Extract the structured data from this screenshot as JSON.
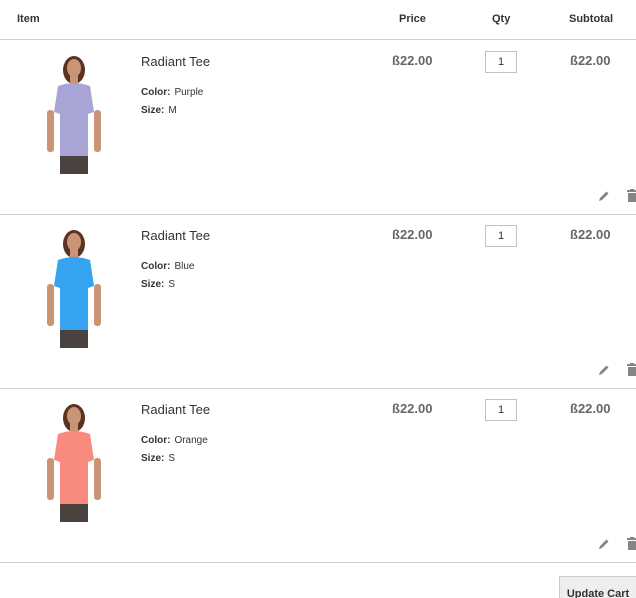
{
  "table_header": {
    "item": "Item",
    "price": "Price",
    "qty": "Qty",
    "subtotal": "Subtotal"
  },
  "labels": {
    "color": "Color:",
    "size": "Size:"
  },
  "items": [
    {
      "name": "Radiant Tee",
      "color": "Purple",
      "size": "M",
      "price": "ß22.00",
      "qty": "1",
      "subtotal": "ß22.00",
      "shirt_color": "#a8a4d6"
    },
    {
      "name": "Radiant Tee",
      "color": "Blue",
      "size": "S",
      "price": "ß22.00",
      "qty": "1",
      "subtotal": "ß22.00",
      "shirt_color": "#35a3f0"
    },
    {
      "name": "Radiant Tee",
      "color": "Orange",
      "size": "S",
      "price": "ß22.00",
      "qty": "1",
      "subtotal": "ß22.00",
      "shirt_color": "#f98b7e"
    }
  ],
  "actions": {
    "update_cart": "Update Cart"
  },
  "icons": {
    "edit": "pencil-icon",
    "delete": "trash-icon"
  }
}
